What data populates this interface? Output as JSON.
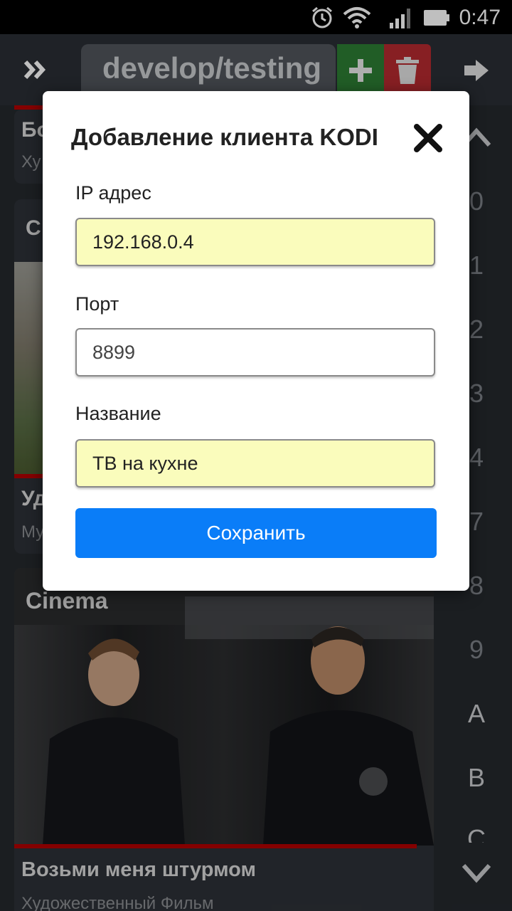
{
  "status_bar": {
    "time": "0:47",
    "icons": [
      "alarm-icon",
      "wifi-icon",
      "signal-icon",
      "battery-icon"
    ]
  },
  "topbar": {
    "branch": "develop/testing",
    "icons": [
      "expand-icon",
      "plus-icon",
      "trash-icon",
      "logout-icon"
    ]
  },
  "cards": [
    {
      "title": "Бо",
      "subtitle": "Ху"
    },
    {
      "title": "С",
      "title2": "Уд",
      "subtitle": "Му"
    },
    {
      "label": "Cinema",
      "title": "Возьми меня штурмом",
      "subtitle": "Художественный Фильм"
    }
  ],
  "alphabet": {
    "letters": [
      "0",
      "1",
      "2",
      "3",
      "4",
      "7",
      "8",
      "9",
      "A",
      "B",
      "C"
    ]
  },
  "modal": {
    "title": "Добавление клиента KODI",
    "ip_label": "IP адрес",
    "ip_value": "192.168.0.4",
    "port_label": "Порт",
    "port_value": "8899",
    "name_label": "Название",
    "name_value": "ТВ на кухне",
    "save_label": "Сохранить"
  },
  "colors": {
    "accent": "#0a7df8",
    "field_highlight": "#fafcbc",
    "add": "#2c7c33",
    "delete": "#b52a2f",
    "progress": "#b00000"
  }
}
